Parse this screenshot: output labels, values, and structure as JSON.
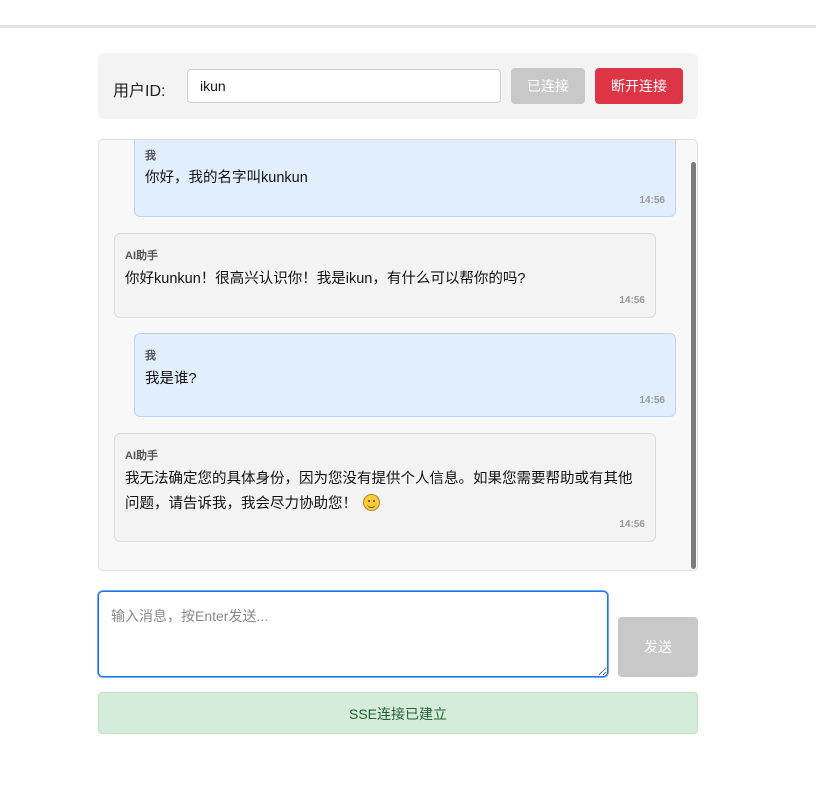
{
  "connection": {
    "user_label": "用户ID:",
    "user_id_value": "ikun",
    "connected_label": "已连接",
    "disconnect_label": "断开连接",
    "disconnect_color": "#dc3545"
  },
  "messages": [
    {
      "role": "user",
      "sender": "我",
      "text": "你好，我的名字叫kunkun",
      "time": "14:56"
    },
    {
      "role": "ai",
      "sender": "AI助手",
      "text": "你好kunkun！很高兴认识你！我是ikun，有什么可以帮你的吗?",
      "time": "14:56"
    },
    {
      "role": "user",
      "sender": "我",
      "text": "我是谁?",
      "time": "14:56"
    },
    {
      "role": "ai",
      "sender": "AI助手",
      "text": "我无法确定您的具体身份，因为您没有提供个人信息。如果您需要帮助或有其他问题，请告诉我，我会尽力协助您！",
      "emoji": "smiling-face-icon",
      "time": "14:56"
    }
  ],
  "composer": {
    "placeholder": "输入消息，按Enter发送...",
    "send_label": "发送"
  },
  "status": {
    "text": "SSE连接已建立",
    "color": "#d5ecd9"
  }
}
